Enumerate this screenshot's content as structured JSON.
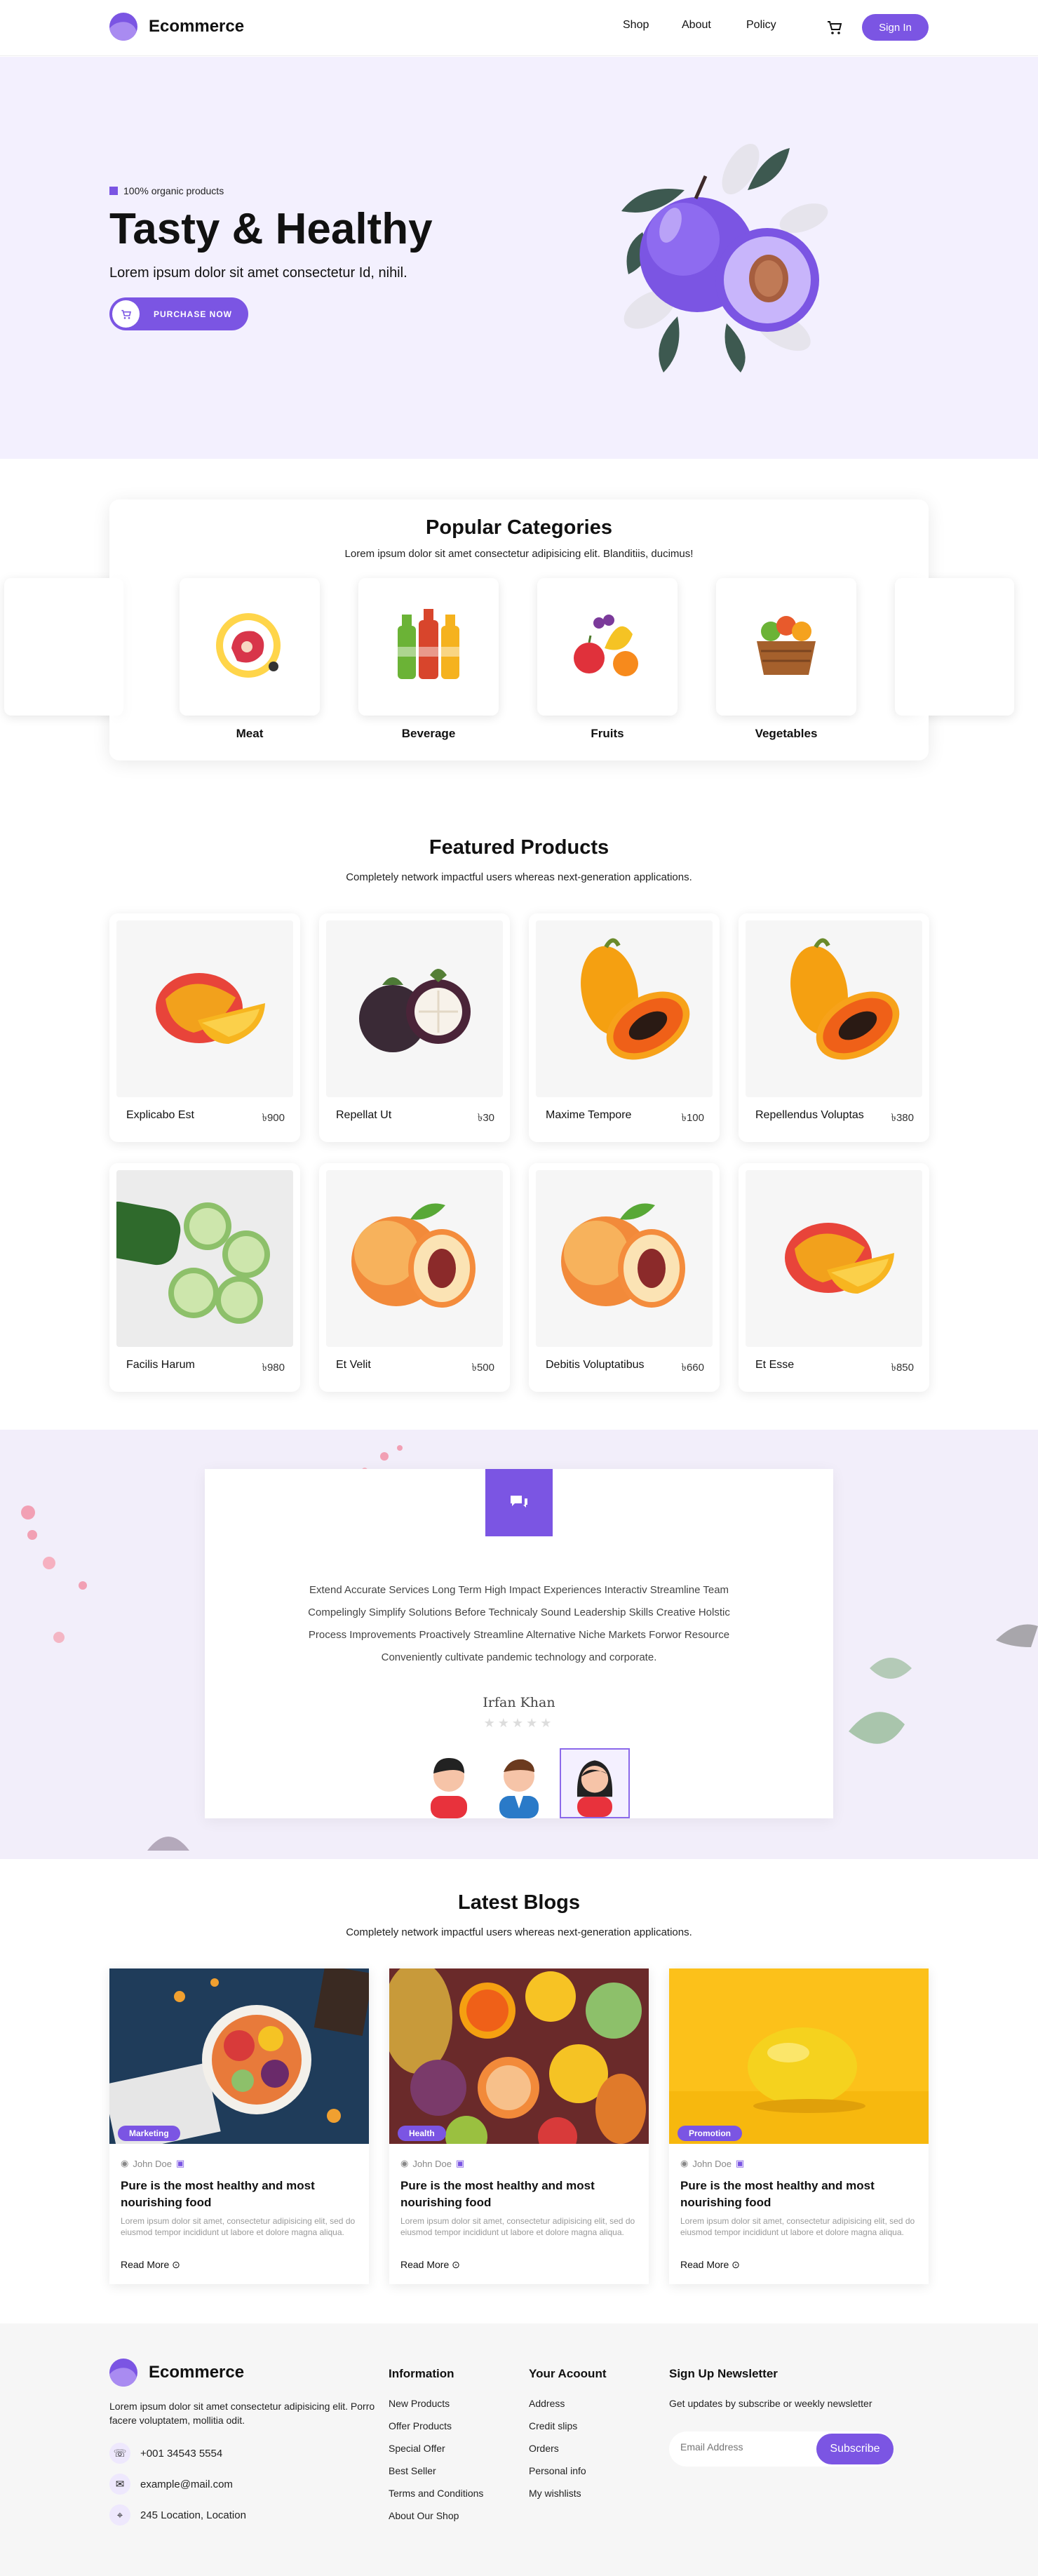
{
  "header": {
    "brand": "Ecommerce",
    "nav": [
      "Shop",
      "About",
      "Policy"
    ],
    "signin_label": "Sign In"
  },
  "hero": {
    "tag": "100% organic products",
    "title": "Tasty & Healthy",
    "subtitle": "Lorem ipsum dolor sit amet consectetur Id, nihil.",
    "cta_label": "PURCHASE NOW"
  },
  "categories": {
    "title": "Popular Categories",
    "subtitle": "Lorem ipsum dolor sit amet consectetur adipisicing elit. Blanditiis, ducimus!",
    "items": [
      "Meat",
      "Beverage",
      "Fruits",
      "Vegetables"
    ]
  },
  "featured": {
    "title": "Featured Products",
    "subtitle": "Completely network impactful users whereas next-generation applications.",
    "currency": "৳",
    "products": [
      {
        "name": "Explicabo Est",
        "price": "900",
        "fruit": "mango"
      },
      {
        "name": "Repellat Ut",
        "price": "30",
        "fruit": "mangosteen"
      },
      {
        "name": "Maxime Tempore",
        "price": "100",
        "fruit": "papaya"
      },
      {
        "name": "Repellendus Voluptas",
        "price": "380",
        "fruit": "papaya"
      },
      {
        "name": "Facilis Harum",
        "price": "980",
        "fruit": "cucumber"
      },
      {
        "name": "Et Velit",
        "price": "500",
        "fruit": "peach"
      },
      {
        "name": "Debitis Voluptatibus",
        "price": "660",
        "fruit": "peach"
      },
      {
        "name": "Et Esse",
        "price": "850",
        "fruit": "mango"
      }
    ]
  },
  "testimonial": {
    "lines": [
      "Extend Accurate Services Long Term High Impact Experiences Interactiv Streamline Team",
      "Compelingly Simplify Solutions Before Technicaly Sound Leadership Skills Creative Holstic",
      "Process Improvements Proactively Streamline Alternative Niche Markets Forwor Resource",
      "Conveniently cultivate pandemic technology and corporate."
    ],
    "name": "Irfan Khan",
    "stars": "★★★★★"
  },
  "blogs": {
    "title": "Latest Blogs",
    "subtitle": "Completely network impactful users whereas next-generation applications.",
    "items": [
      {
        "badge": "Marketing",
        "author": "John Doe",
        "title": "Pure is the most healthy and most nourishing food",
        "excerpt": "Lorem ipsum dolor sit amet, consectetur adipisicing elit, sed do eiusmod tempor incididunt ut labore et dolore magna aliqua.",
        "more": "Read More"
      },
      {
        "badge": "Health",
        "author": "John Doe",
        "title": "Pure is the most healthy and most nourishing food",
        "excerpt": "Lorem ipsum dolor sit amet, consectetur adipisicing elit, sed do eiusmod tempor incididunt ut labore et dolore magna aliqua.",
        "more": "Read More"
      },
      {
        "badge": "Promotion",
        "author": "John Doe",
        "title": "Pure is the most healthy and most nourishing food",
        "excerpt": "Lorem ipsum dolor sit amet, consectetur adipisicing elit, sed do eiusmod tempor incididunt ut labore et dolore magna aliqua.",
        "more": "Read More"
      }
    ]
  },
  "footer": {
    "brand": "Ecommerce",
    "about": "Lorem ipsum dolor sit amet consectetur adipisicing elit. Porro facere voluptatem, mollitia odit.",
    "phone": "+001 34543 5554",
    "email": "example@mail.com",
    "location": "245 Location, Location",
    "info_title": "Information",
    "info_links": [
      "New Products",
      "Offer Products",
      "Special Offer",
      "Best Seller",
      "Terms and Conditions",
      "About Our Shop"
    ],
    "account_title": "Your Acoount",
    "account_links": [
      "Address",
      "Credit slips",
      "Orders",
      "Personal info",
      "My wishlists"
    ],
    "newsletter_title": "Sign Up Newsletter",
    "newsletter_text": "Get updates by subscribe or weekly newsletter",
    "email_placeholder": "Email Address",
    "subscribe_label": "Subscribe"
  },
  "colors": {
    "accent": "#7b55e3",
    "hero_bg": "#f3f0fe",
    "footer_bg": "#f6f6f6"
  }
}
